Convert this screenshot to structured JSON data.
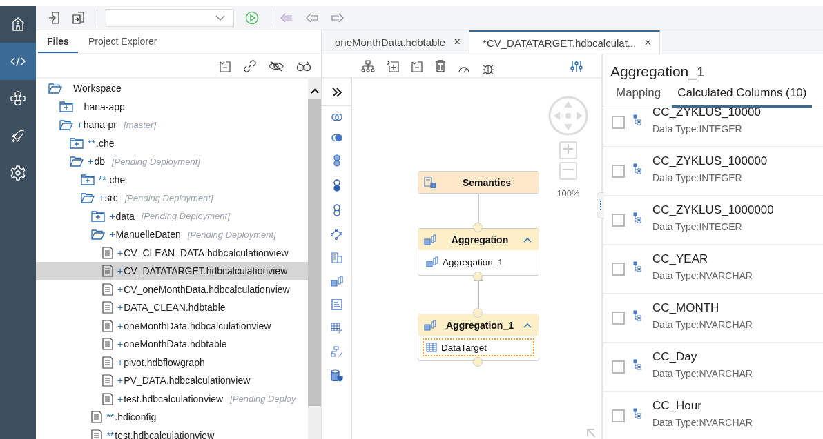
{
  "sidebar": {
    "items": [
      {
        "kind": "home",
        "selected": false
      },
      {
        "kind": "code",
        "selected": true
      },
      {
        "kind": "cubes",
        "selected": false
      },
      {
        "kind": "rocket",
        "selected": false
      },
      {
        "kind": "gear",
        "selected": false
      }
    ]
  },
  "left_panel": {
    "tabs": [
      {
        "label": "Files",
        "selected": true
      },
      {
        "label": "Project Explorer",
        "selected": false
      }
    ],
    "tree": [
      {
        "kind": "folder",
        "expanded": true,
        "name": "Workspace",
        "selected": false,
        "children": [
          {
            "kind": "folder",
            "expanded": false,
            "name": "hana-app",
            "selected": false
          },
          {
            "kind": "folder",
            "expanded": true,
            "marker": "+",
            "name": "hana-pr",
            "status": "[master]",
            "selected": false,
            "children": [
              {
                "kind": "folder",
                "expanded": false,
                "marker": "**",
                "name": ".che",
                "selected": false
              },
              {
                "kind": "folder",
                "expanded": true,
                "marker": "+",
                "name": "db",
                "status": "[Pending Deployment]",
                "selected": false,
                "children": [
                  {
                    "kind": "folder",
                    "expanded": false,
                    "marker": "**",
                    "name": ".che",
                    "selected": false
                  },
                  {
                    "kind": "folder",
                    "expanded": true,
                    "marker": "+",
                    "name": "src",
                    "status": "[Pending Deployment]",
                    "selected": false,
                    "children": [
                      {
                        "kind": "folder",
                        "expanded": false,
                        "marker": "+",
                        "name": "data",
                        "status": "[Pending Deployment]",
                        "selected": false
                      },
                      {
                        "kind": "folder",
                        "expanded": true,
                        "marker": "+",
                        "name": "ManuelleDaten",
                        "status": "[Pending Deployment]",
                        "selected": false,
                        "children": [
                          {
                            "kind": "file",
                            "marker": "+",
                            "name": "CV_CLEAN_DATA.hdbcalculationview",
                            "selected": false
                          },
                          {
                            "kind": "file",
                            "marker": "+",
                            "name": "CV_DATATARGET.hdbcalculationview",
                            "selected": true
                          },
                          {
                            "kind": "file",
                            "marker": "+",
                            "name": "CV_oneMonthData.hdbcalculationview",
                            "selected": false
                          },
                          {
                            "kind": "file",
                            "marker": "+",
                            "name": "DATA_CLEAN.hdbtable",
                            "selected": false
                          },
                          {
                            "kind": "file",
                            "marker": "+",
                            "name": "oneMonthData.hdbcalculationview",
                            "selected": false
                          },
                          {
                            "kind": "file",
                            "marker": "+",
                            "name": "oneMonthData.hdbtable",
                            "selected": false
                          },
                          {
                            "kind": "file",
                            "marker": "+",
                            "name": "pivot.hdbflowgraph",
                            "selected": false
                          },
                          {
                            "kind": "file",
                            "marker": "+",
                            "name": "PV_DATA.hdbcalculationview",
                            "selected": false
                          },
                          {
                            "kind": "file",
                            "marker": "+",
                            "name": "test.hdbcalculationview",
                            "status": "[Pending Deploy",
                            "selected": false
                          }
                        ]
                      },
                      {
                        "kind": "file",
                        "marker": "**",
                        "name": ".hdiconfig",
                        "selected": false
                      },
                      {
                        "kind": "file",
                        "marker": "**",
                        "name": "test.hdbcalculationview",
                        "selected": false
                      }
                    ]
                  }
                ]
              }
            ]
          }
        ]
      }
    ]
  },
  "editor": {
    "tabs": [
      {
        "label": "oneMonthData.hdbtable",
        "close": "×",
        "selected": false
      },
      {
        "label": "*CV_DATATARGET.hdbcalculat...",
        "close": "×",
        "selected": true
      }
    ],
    "zoom": "100%",
    "nodes": [
      {
        "kind": "semantics",
        "title": "Semantics",
        "expanded": false
      },
      {
        "kind": "aggregation",
        "title": "Aggregation",
        "expanded": true,
        "inputs": [
          {
            "kind": "aggregation",
            "label": "Aggregation_1",
            "selected": false
          }
        ]
      },
      {
        "kind": "aggregation",
        "title": "Aggregation_1",
        "expanded": true,
        "inputs": [
          {
            "kind": "table",
            "label": "DataTarget",
            "selected": true
          }
        ]
      }
    ]
  },
  "properties": {
    "title": "Aggregation_1",
    "tabs": [
      {
        "label": "Mapping",
        "selected": false
      },
      {
        "label": "Calculated Columns (10)",
        "selected": true
      }
    ],
    "columns": [
      {
        "name": "CC_ZYKLUS_10000",
        "type": "Data Type:INTEGER",
        "checked": false
      },
      {
        "name": "CC_ZYKLUS_100000",
        "type": "Data Type:INTEGER",
        "checked": false
      },
      {
        "name": "CC_ZYKLUS_1000000",
        "type": "Data Type:INTEGER",
        "checked": false
      },
      {
        "name": "CC_YEAR",
        "type": "Data Type:NVARCHAR",
        "checked": false
      },
      {
        "name": "CC_MONTH",
        "type": "Data Type:NVARCHAR",
        "checked": false
      },
      {
        "name": "CC_Day",
        "type": "Data Type:NVARCHAR",
        "checked": false
      },
      {
        "name": "CC_Hour",
        "type": "Data Type:NVARCHAR",
        "checked": false
      }
    ]
  }
}
